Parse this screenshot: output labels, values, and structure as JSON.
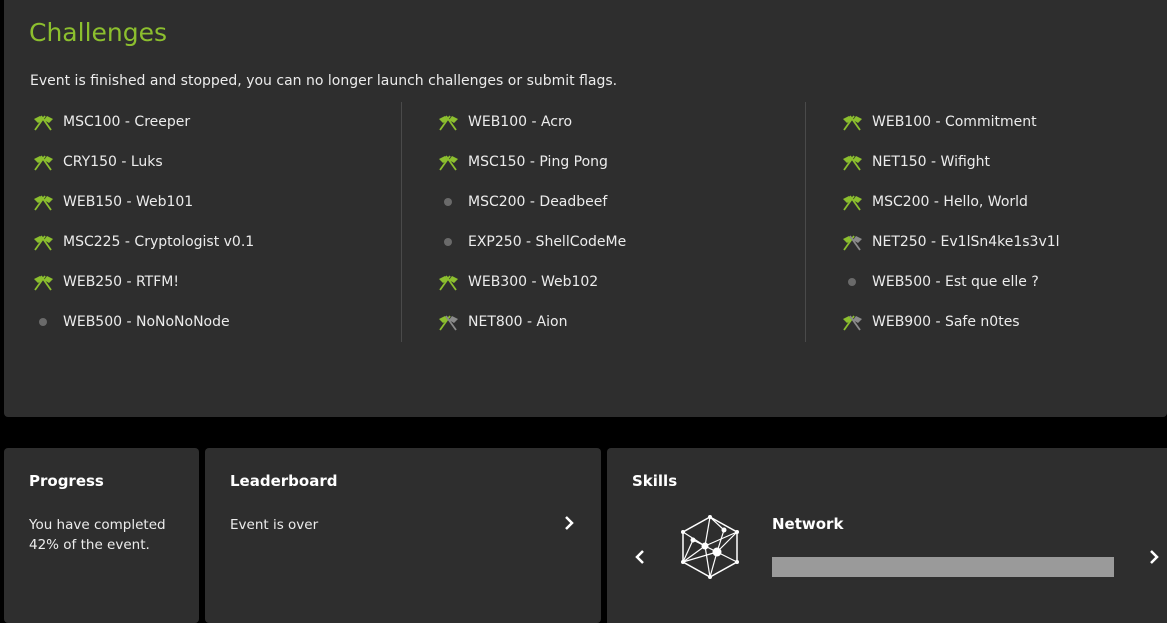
{
  "challenges": {
    "title": "Challenges",
    "notice": "Event is finished and stopped, you can no longer launch challenges or submit flags.",
    "columns": [
      [
        {
          "label": "MSC100 - Creeper",
          "status": "solved"
        },
        {
          "label": "CRY150 - Luks",
          "status": "solved"
        },
        {
          "label": "WEB150 - Web101",
          "status": "solved"
        },
        {
          "label": "MSC225 - Cryptologist v0.1",
          "status": "solved"
        },
        {
          "label": "WEB250 - RTFM!",
          "status": "solved"
        },
        {
          "label": "WEB500 - NoNoNoNode",
          "status": "unsolved"
        }
      ],
      [
        {
          "label": "WEB100 - Acro",
          "status": "solved"
        },
        {
          "label": "MSC150 - Ping Pong",
          "status": "solved"
        },
        {
          "label": "MSC200 - Deadbeef",
          "status": "unsolved"
        },
        {
          "label": "EXP250 - ShellCodeMe",
          "status": "unsolved"
        },
        {
          "label": "WEB300 - Web102",
          "status": "solved"
        },
        {
          "label": "NET800 - Aion",
          "status": "partial"
        }
      ],
      [
        {
          "label": "WEB100 - Commitment",
          "status": "solved"
        },
        {
          "label": "NET150 - Wifight",
          "status": "solved"
        },
        {
          "label": "MSC200 - Hello, World",
          "status": "solved"
        },
        {
          "label": "NET250 - Ev1lSn4ke1s3v1l",
          "status": "partial"
        },
        {
          "label": "WEB500 - Est que elle ?",
          "status": "unsolved"
        },
        {
          "label": "WEB900 - Safe n0tes",
          "status": "partial"
        }
      ]
    ],
    "icons": {
      "solved": "crossed-flags-icon",
      "partial": "half-crossed-flags-icon",
      "unsolved": "dot-icon"
    }
  },
  "progress": {
    "title": "Progress",
    "text": "You have completed 42% of the event."
  },
  "leaderboard": {
    "title": "Leaderboard",
    "text": "Event is over"
  },
  "skills": {
    "title": "Skills",
    "current": "Network",
    "level": 1.0,
    "icon": "network-hexagon-icon"
  },
  "colors": {
    "accent": "#8cbf2e",
    "panel": "#2e2e2e",
    "background": "#000000",
    "inactive": "#6a6a6a"
  }
}
